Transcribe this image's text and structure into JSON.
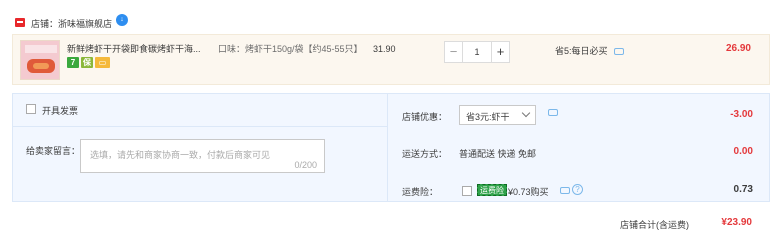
{
  "shop": {
    "label": "店铺：浙味福旗舰店",
    "badge": "↓",
    "tmall_icon": "tmall-logo-icon"
  },
  "item": {
    "title": "新鲜烤虾干开袋即食碳烤虾干海...",
    "service_icons": [
      {
        "name": "seven-day-return-icon",
        "glyph": "7"
      },
      {
        "name": "guarantee-icon",
        "glyph": "保"
      },
      {
        "name": "credit-card-icon",
        "glyph": "▭"
      }
    ],
    "sku": "口味：烤虾干150g/袋【约45-55只】",
    "unit_price": "31.90",
    "quantity": "1",
    "minus": "−",
    "plus": "+",
    "promo": "省5:每日必买",
    "total": "26.90"
  },
  "order": {
    "invoice_label": "开具发票",
    "message_label": "给卖家留言：",
    "message_placeholder": "选填，请先和商家协商一致，付款后商家可见",
    "message_counter": "0/200",
    "coupon_label": "店铺优惠：",
    "coupon_value": "省3元:虾干",
    "coupon_amount": "-3.00",
    "shipping_label": "运送方式：",
    "shipping_value": "普通配送 快递 免邮",
    "shipping_amount": "0.00",
    "insurance_label": "运费险：",
    "insurance_tag": "运费险",
    "insurance_price": "¥0.73购买",
    "insurance_amount": "0.73"
  },
  "summary": {
    "label": "店铺合计(含运费)",
    "amount": "¥23.90"
  },
  "colors": {
    "accent_red": "#e4393c",
    "panel_blue": "#f2f7ff",
    "item_bg": "#fcf7ef"
  }
}
